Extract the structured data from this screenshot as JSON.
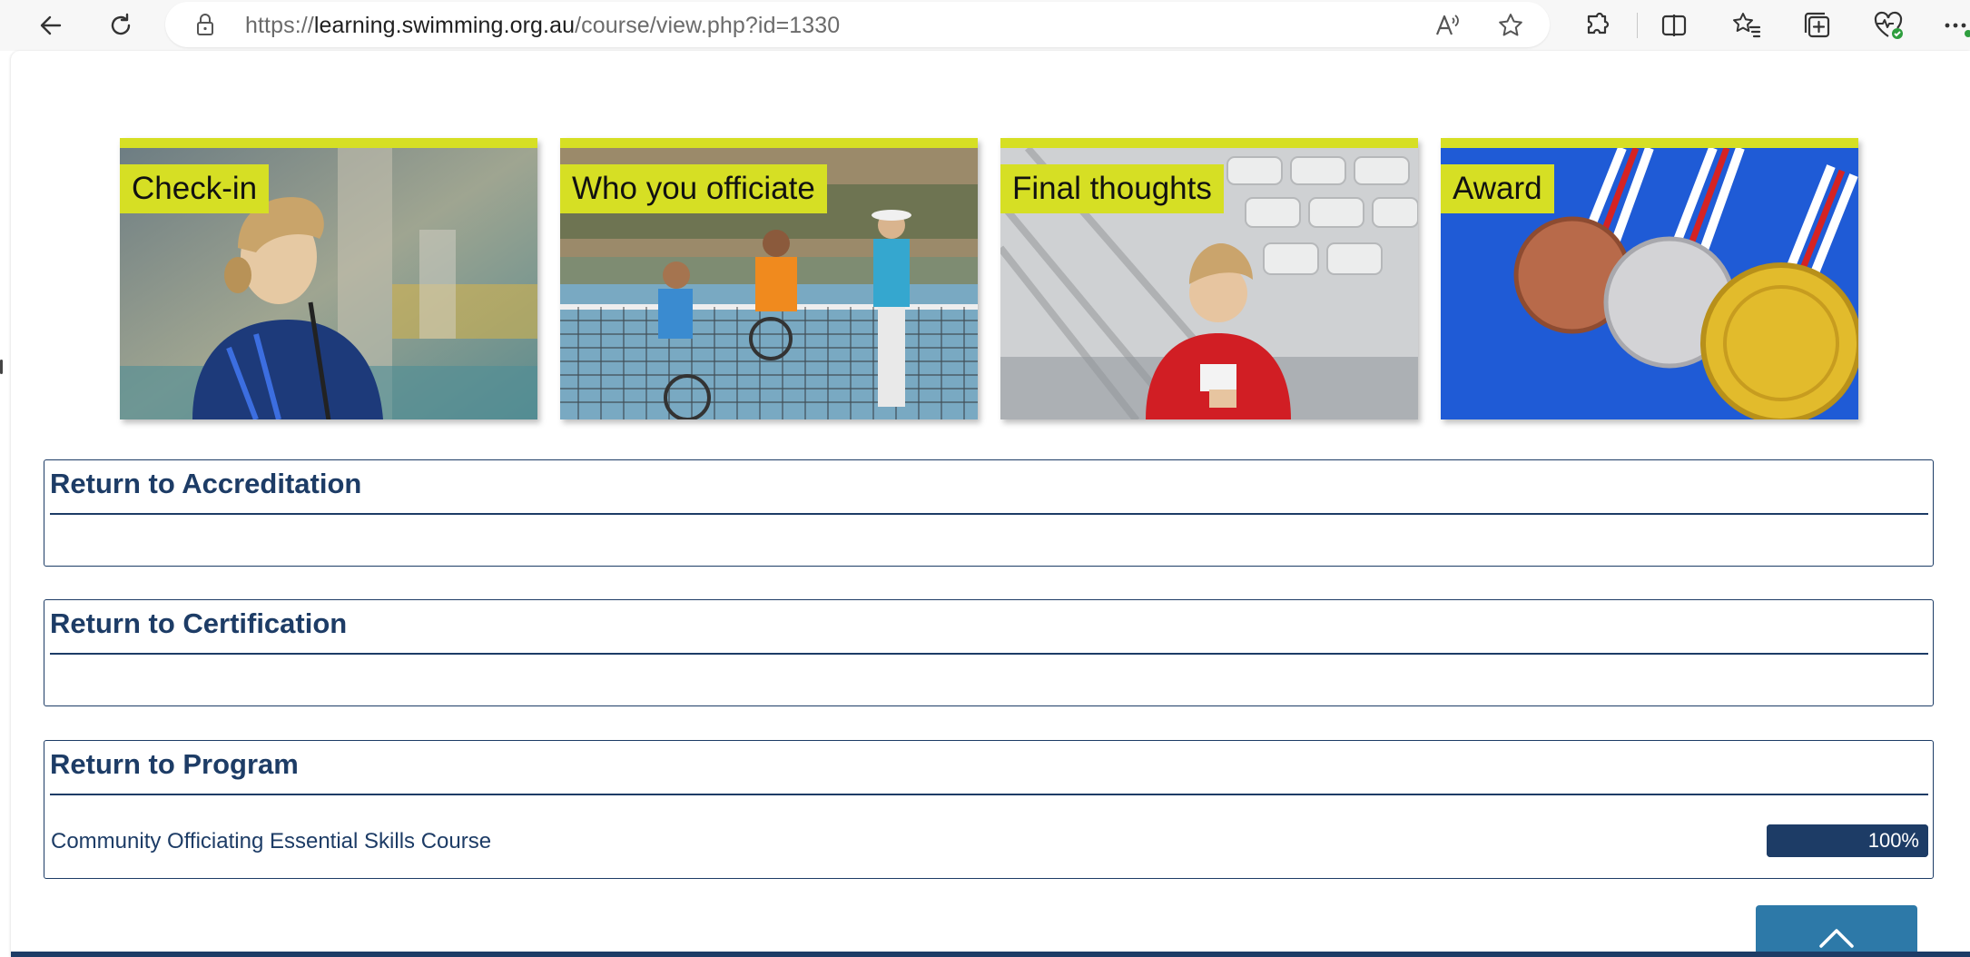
{
  "browser": {
    "url_prefix": "https://",
    "url_host": "learning.swimming.org.au",
    "url_path": "/course/view.php?id=1330"
  },
  "tiles": [
    {
      "label": "Check-in"
    },
    {
      "label": "Who you officiate"
    },
    {
      "label": "Final thoughts"
    },
    {
      "label": "Award"
    }
  ],
  "sections": {
    "accreditation": {
      "title": "Return to Accreditation"
    },
    "certification": {
      "title": "Return to Certification"
    },
    "program": {
      "title": "Return to Program",
      "course": {
        "name": "Community Officiating Essential Skills Course",
        "progress_text": "100%",
        "progress": 1.0
      }
    }
  },
  "colors": {
    "accent_yellow": "#d6df24",
    "navy": "#1d3c66",
    "top_button": "#2d79a8"
  },
  "icons": [
    "back-icon",
    "refresh-icon",
    "lock-icon",
    "read-aloud-icon",
    "favorite-icon",
    "extensions-icon",
    "split-screen-icon",
    "favorites-icon",
    "collections-icon",
    "browser-essentials-icon",
    "more-icon",
    "chevron-up-icon"
  ]
}
